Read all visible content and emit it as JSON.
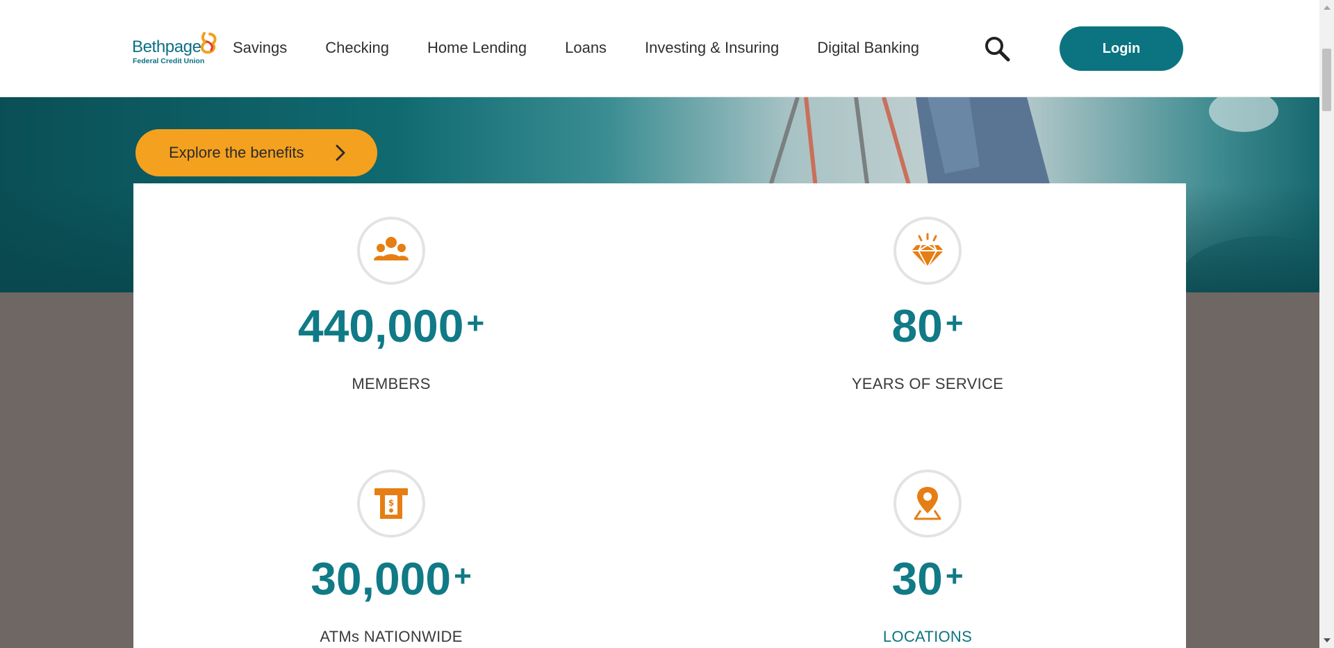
{
  "brand": {
    "name": "Bethpage",
    "sub": "Federal Credit Union",
    "color": "#0b6f86",
    "accent": "#f4a11f"
  },
  "nav": {
    "items": [
      {
        "label": "Savings"
      },
      {
        "label": "Checking"
      },
      {
        "label": "Home Lending"
      },
      {
        "label": "Loans"
      },
      {
        "label": "Investing & Insuring"
      },
      {
        "label": "Digital Banking"
      }
    ],
    "search_icon": "search-icon",
    "login_label": "Login"
  },
  "hero": {
    "cta_label": "Explore the benefits",
    "cta_icon": "chevron-right-icon"
  },
  "stats": [
    {
      "number": "440,000",
      "suffix": "+",
      "label": "MEMBERS",
      "icon": "members-icon"
    },
    {
      "number": "80",
      "suffix": "+",
      "label": "YEARS OF SERVICE",
      "icon": "diamond-icon"
    },
    {
      "number": "30,000",
      "suffix": "+",
      "label": "ATMs NATIONWIDE",
      "icon": "atm-icon"
    },
    {
      "number": "30",
      "suffix": "+",
      "label": "LOCATIONS",
      "icon": "location-pin-icon"
    }
  ],
  "colors": {
    "teal": "#107a86",
    "icon_orange": "#e67e14",
    "button_teal": "#0b7480"
  }
}
